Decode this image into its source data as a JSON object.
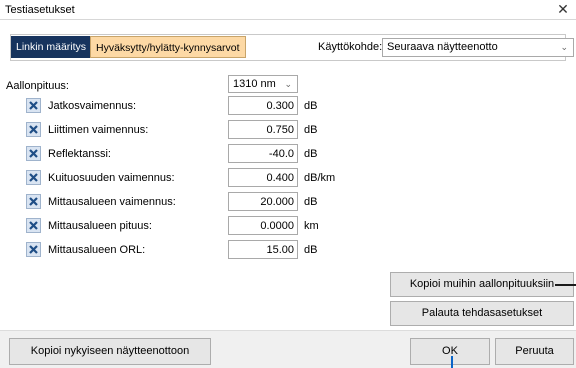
{
  "window": {
    "title": "Testiasetukset",
    "close_glyph": "✕"
  },
  "tabs": [
    {
      "label": "Linkin määritys",
      "active": false
    },
    {
      "label": "Hyväksytty/hylätty-kynnysarvot",
      "active": true
    }
  ],
  "usage": {
    "label": "Käyttökohde:",
    "value": "Seuraava näytteenotto"
  },
  "wavelength": {
    "label": "Aallonpituus:",
    "value": "1310 nm"
  },
  "thresholds": [
    {
      "label": "Jatkosvaimennus:",
      "value": "0.300",
      "unit": "dB",
      "checked": true
    },
    {
      "label": "Liittimen vaimennus:",
      "value": "0.750",
      "unit": "dB",
      "checked": true
    },
    {
      "label": "Reflektanssi:",
      "value": "-40.0",
      "unit": "dB",
      "checked": true
    },
    {
      "label": "Kuituosuuden vaimennus:",
      "value": "0.400",
      "unit": "dB/km",
      "checked": true
    },
    {
      "label": "Mittausalueen vaimennus:",
      "value": "20.000",
      "unit": "dB",
      "checked": true
    },
    {
      "label": "Mittausalueen pituus:",
      "value": "0.0000",
      "unit": "km",
      "checked": true
    },
    {
      "label": "Mittausalueen ORL:",
      "value": "15.00",
      "unit": "dB",
      "checked": true
    }
  ],
  "buttons": {
    "copy_all": "Kopioi muihin aallonpituuksiin",
    "reset": "Palauta tehdasasetukset",
    "copy_current": "Kopioi nykyiseen näytteenottoon",
    "ok": "OK",
    "cancel": "Peruuta"
  },
  "colors": {
    "tab_inactive_bg": "#17345e",
    "tab_active_bg": "#fdd9a5",
    "checkbox_x": "#1f4e86"
  },
  "icons": {
    "checkbox": "x-mark-icon",
    "dropdown": "chevron-down-icon",
    "close": "close-icon"
  }
}
